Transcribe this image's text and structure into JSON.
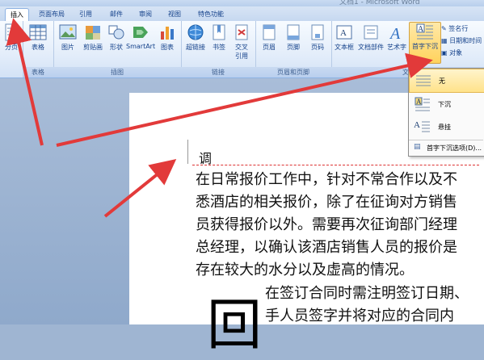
{
  "window": {
    "title": "文档1 - Microsoft Word"
  },
  "tabs": [
    {
      "label": "插入",
      "active": true
    },
    {
      "label": "页面布局"
    },
    {
      "label": "引用"
    },
    {
      "label": "邮件"
    },
    {
      "label": "审阅"
    },
    {
      "label": "视图"
    },
    {
      "label": "特色功能"
    }
  ],
  "ribbon": {
    "groups": {
      "table": "表格",
      "illustrations": "插图",
      "links": "链接",
      "header_footer": "页眉和页脚",
      "text": "文"
    },
    "buttons": {
      "page_break": "分页",
      "table": "表格",
      "picture": "图片",
      "clipart": "剪贴画",
      "shapes": "形状",
      "smartart": "SmartArt",
      "chart": "图表",
      "hyperlink": "超链接",
      "bookmark": "书签",
      "cross_ref_1": "交叉",
      "cross_ref_2": "引用",
      "header": "页眉",
      "footer": "页脚",
      "page_number": "页码",
      "textbox": "文本框",
      "quickparts": "文档部件",
      "wordart": "艺术字",
      "dropcap": "首字下沉",
      "signature_line": "签名行",
      "datetime": "日期和时间",
      "object": "对象"
    }
  },
  "dropdown": {
    "items": [
      "无",
      "下沉",
      "悬挂"
    ],
    "options": "首字下沉选项(D)..."
  },
  "document": {
    "heading": "调",
    "lines": [
      "在日常报价工作中，针对不常合作以及不",
      "悉酒店的相关报价，除了在征询对方销售",
      "员获得报价以外。需要再次征询部门经理",
      "总经理，以确认该酒店销售人员的报价是",
      "存在较大的水分以及虚高的情况。"
    ],
    "dropcap_char": "回",
    "dropcap_lines": [
      "在签订合同时需注明签订日期、",
      "手人员签字并将对应的合同内"
    ]
  },
  "colors": {
    "arrow": "#e23a3a",
    "ribbon_text": "#15428b"
  }
}
